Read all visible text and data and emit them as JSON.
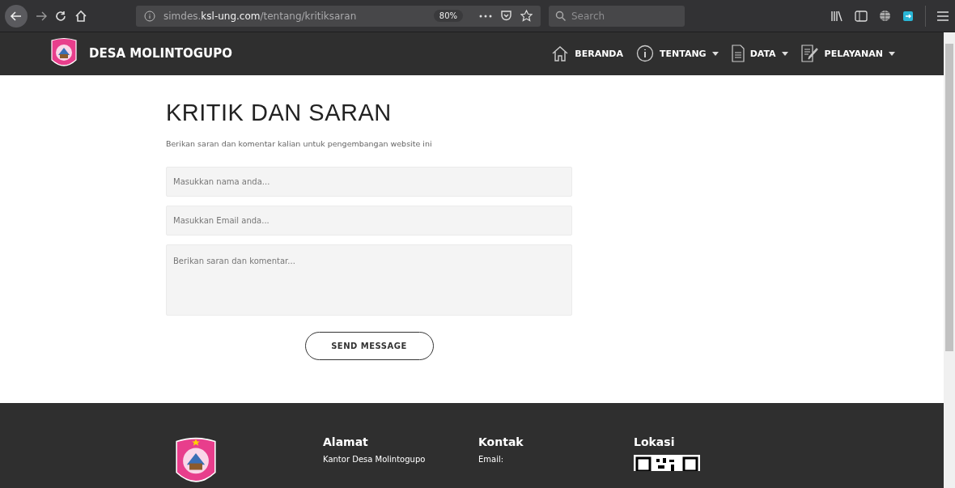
{
  "browser": {
    "url": {
      "host": "simdes.",
      "domain": "ksl-ung.com",
      "path": "/tentang/kritiksaran"
    },
    "zoom": "80%",
    "search": {
      "placeholder": "Search"
    }
  },
  "navbar": {
    "brand": "DESA MOLINTOGUPO",
    "items": [
      {
        "kind": "home",
        "label": "BERANDA",
        "dropdown": false
      },
      {
        "kind": "info",
        "label": "TENTANG",
        "dropdown": true
      },
      {
        "kind": "document",
        "label": "DATA",
        "dropdown": true
      },
      {
        "kind": "edit",
        "label": "PELAYANAN",
        "dropdown": true
      }
    ]
  },
  "form": {
    "title": "KRITIK DAN SARAN",
    "subtitle": "Berikan saran dan komentar kalian untuk pengembangan website ini",
    "fields": [
      {
        "kind": "input",
        "placeholder": "Masukkan nama anda..."
      },
      {
        "kind": "input",
        "placeholder": "Masukkan Email anda..."
      },
      {
        "kind": "textarea",
        "placeholder": "Berikan saran dan komentar..."
      }
    ],
    "button": "SEND MESSAGE"
  },
  "footer": {
    "columns": [
      {
        "kind": "text",
        "heading": "Alamat",
        "lines": [
          "Kantor Desa Molintogupo"
        ]
      },
      {
        "kind": "text",
        "heading": "Kontak",
        "lines": [
          "Email:"
        ]
      },
      {
        "kind": "qr",
        "heading": "Lokasi"
      }
    ]
  }
}
